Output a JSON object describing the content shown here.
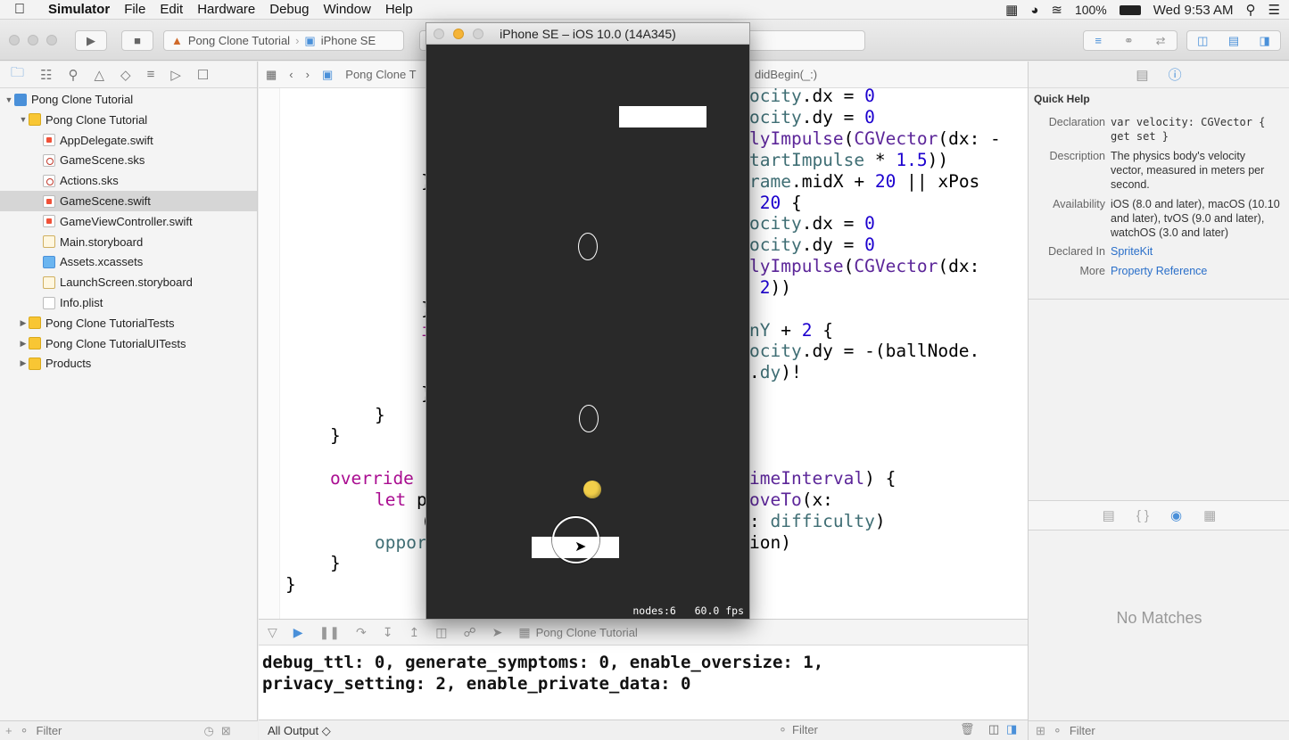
{
  "menubar": {
    "app_name": "Simulator",
    "items": [
      "File",
      "Edit",
      "Hardware",
      "Debug",
      "Window",
      "Help"
    ],
    "battery": "100%",
    "clock": "Wed 9:53 AM"
  },
  "toolbar": {
    "scheme": "Pong Clone Tutorial",
    "device": "iPhone SE"
  },
  "navigator": {
    "tree": [
      {
        "label": "Pong Clone Tutorial",
        "type": "proj",
        "depth": 0,
        "disclosure": "open"
      },
      {
        "label": "Pong Clone Tutorial",
        "type": "folder",
        "depth": 1,
        "disclosure": "open"
      },
      {
        "label": "AppDelegate.swift",
        "type": "swift",
        "depth": 2
      },
      {
        "label": "GameScene.sks",
        "type": "sks",
        "depth": 2
      },
      {
        "label": "Actions.sks",
        "type": "sks",
        "depth": 2
      },
      {
        "label": "GameScene.swift",
        "type": "swift",
        "depth": 2,
        "selected": true
      },
      {
        "label": "GameViewController.swift",
        "type": "swift",
        "depth": 2
      },
      {
        "label": "Main.storyboard",
        "type": "board",
        "depth": 2
      },
      {
        "label": "Assets.xcassets",
        "type": "assets",
        "depth": 2
      },
      {
        "label": "LaunchScreen.storyboard",
        "type": "board",
        "depth": 2
      },
      {
        "label": "Info.plist",
        "type": "plist",
        "depth": 2
      },
      {
        "label": "Pong Clone TutorialTests",
        "type": "folder",
        "depth": 1,
        "disclosure": "closed"
      },
      {
        "label": "Pong Clone TutorialUITests",
        "type": "folder",
        "depth": 1,
        "disclosure": "closed"
      },
      {
        "label": "Products",
        "type": "folder",
        "depth": 1,
        "disclosure": "closed"
      }
    ],
    "filter_placeholder": "Filter"
  },
  "editor": {
    "jump_file": "Pong Clone T",
    "jump_symbol": "didBegin(_:)"
  },
  "simulator": {
    "title": "iPhone SE – iOS 10.0 (14A345)",
    "stats_nodes": "nodes:6",
    "stats_fps": "60.0 fps"
  },
  "debug": {
    "target_label": "Pong Clone Tutorial",
    "console_lines": [
      "debug_ttl: 0, generate_symptoms: 0, enable_oversize: 1,",
      "privacy_setting: 2, enable_private_data: 0"
    ],
    "output_selector": "All Output ◇",
    "filter_placeholder": "Filter"
  },
  "quick_help": {
    "title": "Quick Help",
    "rows": [
      {
        "label": "Declaration",
        "value": "var velocity: CGVector { get set }"
      },
      {
        "label": "Description",
        "value": "The physics body's velocity vector, measured in meters per second."
      },
      {
        "label": "Availability",
        "value": "iOS (8.0 and later), macOS (10.10 and later), tvOS (9.0 and later), watchOS (3.0 and later)"
      },
      {
        "label": "Declared In",
        "value": "SpriteKit"
      },
      {
        "label": "More",
        "value": "Property Reference"
      }
    ],
    "no_matches": "No Matches",
    "filter_placeholder": "Filter"
  }
}
